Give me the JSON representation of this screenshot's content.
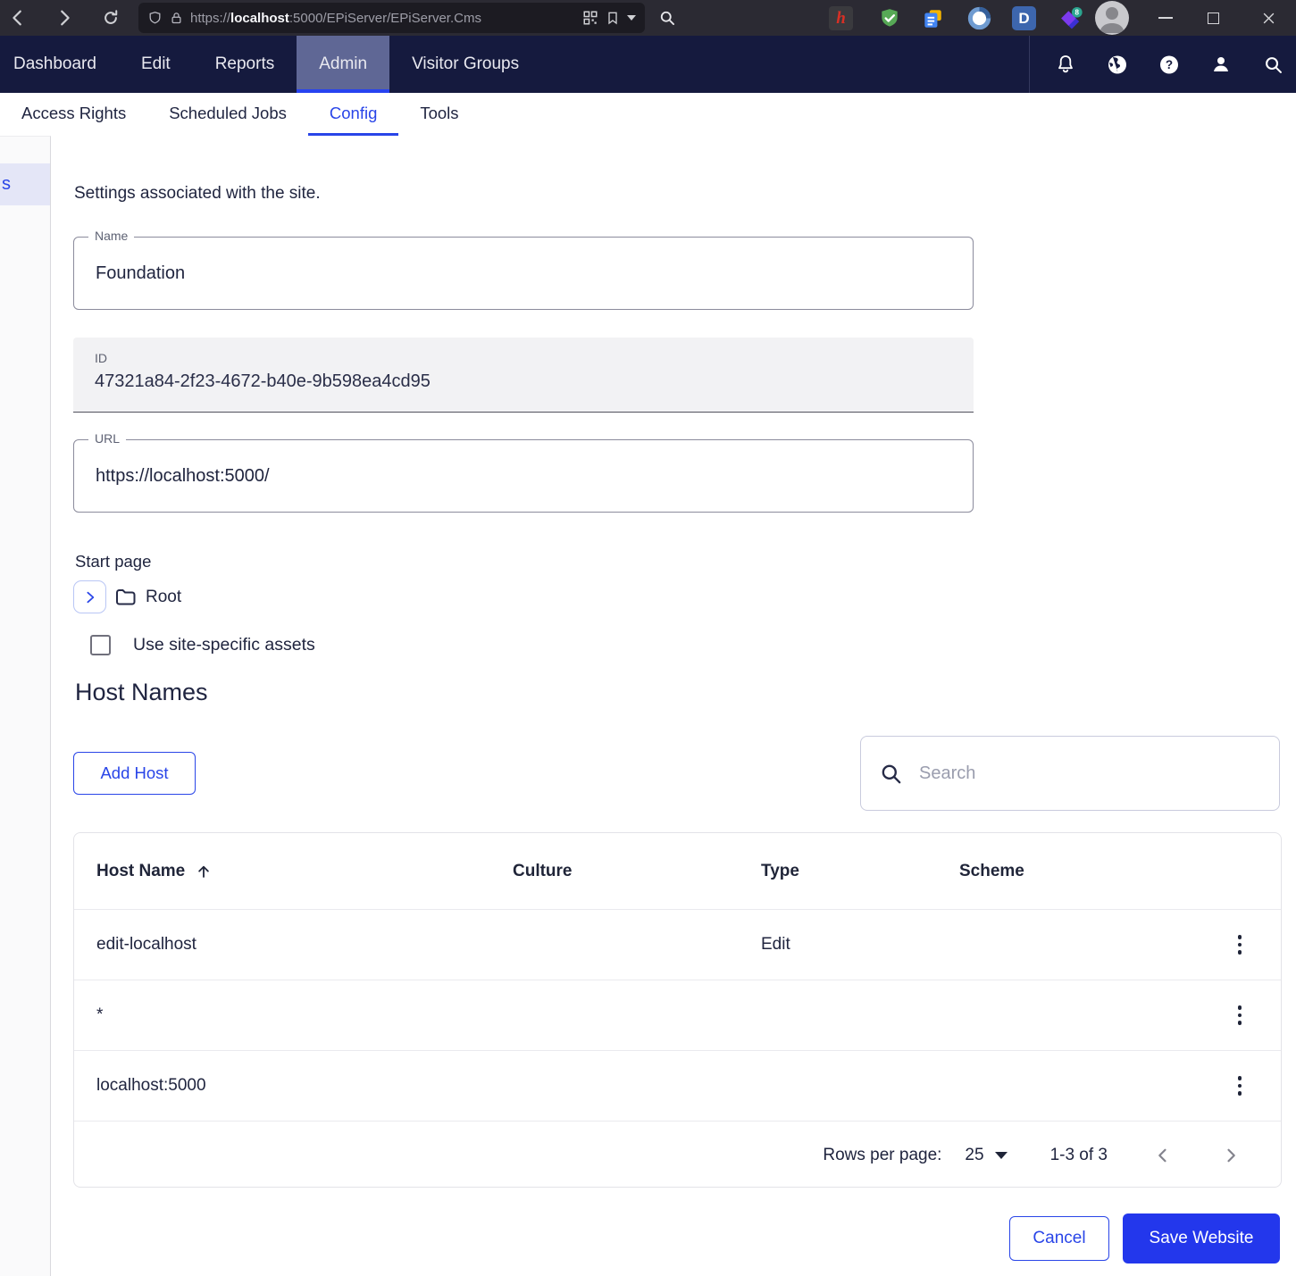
{
  "browser": {
    "url": {
      "scheme": "https://",
      "host": "localhost",
      "path": ":5000/EPiServer/EPiServer.Cms"
    },
    "extensions": {
      "h_glyph": "h",
      "d_glyph": "D",
      "purple_badge": "8"
    }
  },
  "nav": {
    "items": [
      "Dashboard",
      "Edit",
      "Reports",
      "Admin",
      "Visitor Groups"
    ],
    "active": "Admin"
  },
  "tabs": {
    "items": [
      "Access Rights",
      "Scheduled Jobs",
      "Config",
      "Tools"
    ],
    "active": "Config"
  },
  "sidebar": {
    "selected_item": "s"
  },
  "settings": {
    "intro": "Settings associated with the site.",
    "name": {
      "label": "Name",
      "value": "Foundation"
    },
    "id": {
      "label": "ID",
      "value": "47321a84-2f23-4672-b40e-9b598ea4cd95"
    },
    "url": {
      "label": "URL",
      "value": "https://localhost:5000/"
    },
    "start_page": {
      "label": "Start page",
      "node": "Root"
    },
    "assets_checkbox_label": "Use site-specific assets"
  },
  "host_names": {
    "heading": "Host Names",
    "add_button": "Add Host",
    "search_placeholder": "Search",
    "table": {
      "columns": [
        "Host Name",
        "Culture",
        "Type",
        "Scheme"
      ],
      "rows": [
        {
          "host": "edit-localhost",
          "culture": "",
          "type": "Edit",
          "scheme": ""
        },
        {
          "host": "*",
          "culture": "",
          "type": "",
          "scheme": ""
        },
        {
          "host": "localhost:5000",
          "culture": "",
          "type": "",
          "scheme": ""
        }
      ]
    },
    "pagination": {
      "label": "Rows per page:",
      "value": "25",
      "range": "1-3 of 3"
    }
  },
  "actions": {
    "cancel": "Cancel",
    "save": "Save Website"
  },
  "colors": {
    "accent_blue": "#2945e8",
    "nav_underline": "#2742f0",
    "nav_bg": "#151a3e",
    "nav_active_bg": "#5f6795",
    "save_button_bg": "#2337ec",
    "sidebar_selected_bg": "#e4e6f7"
  }
}
